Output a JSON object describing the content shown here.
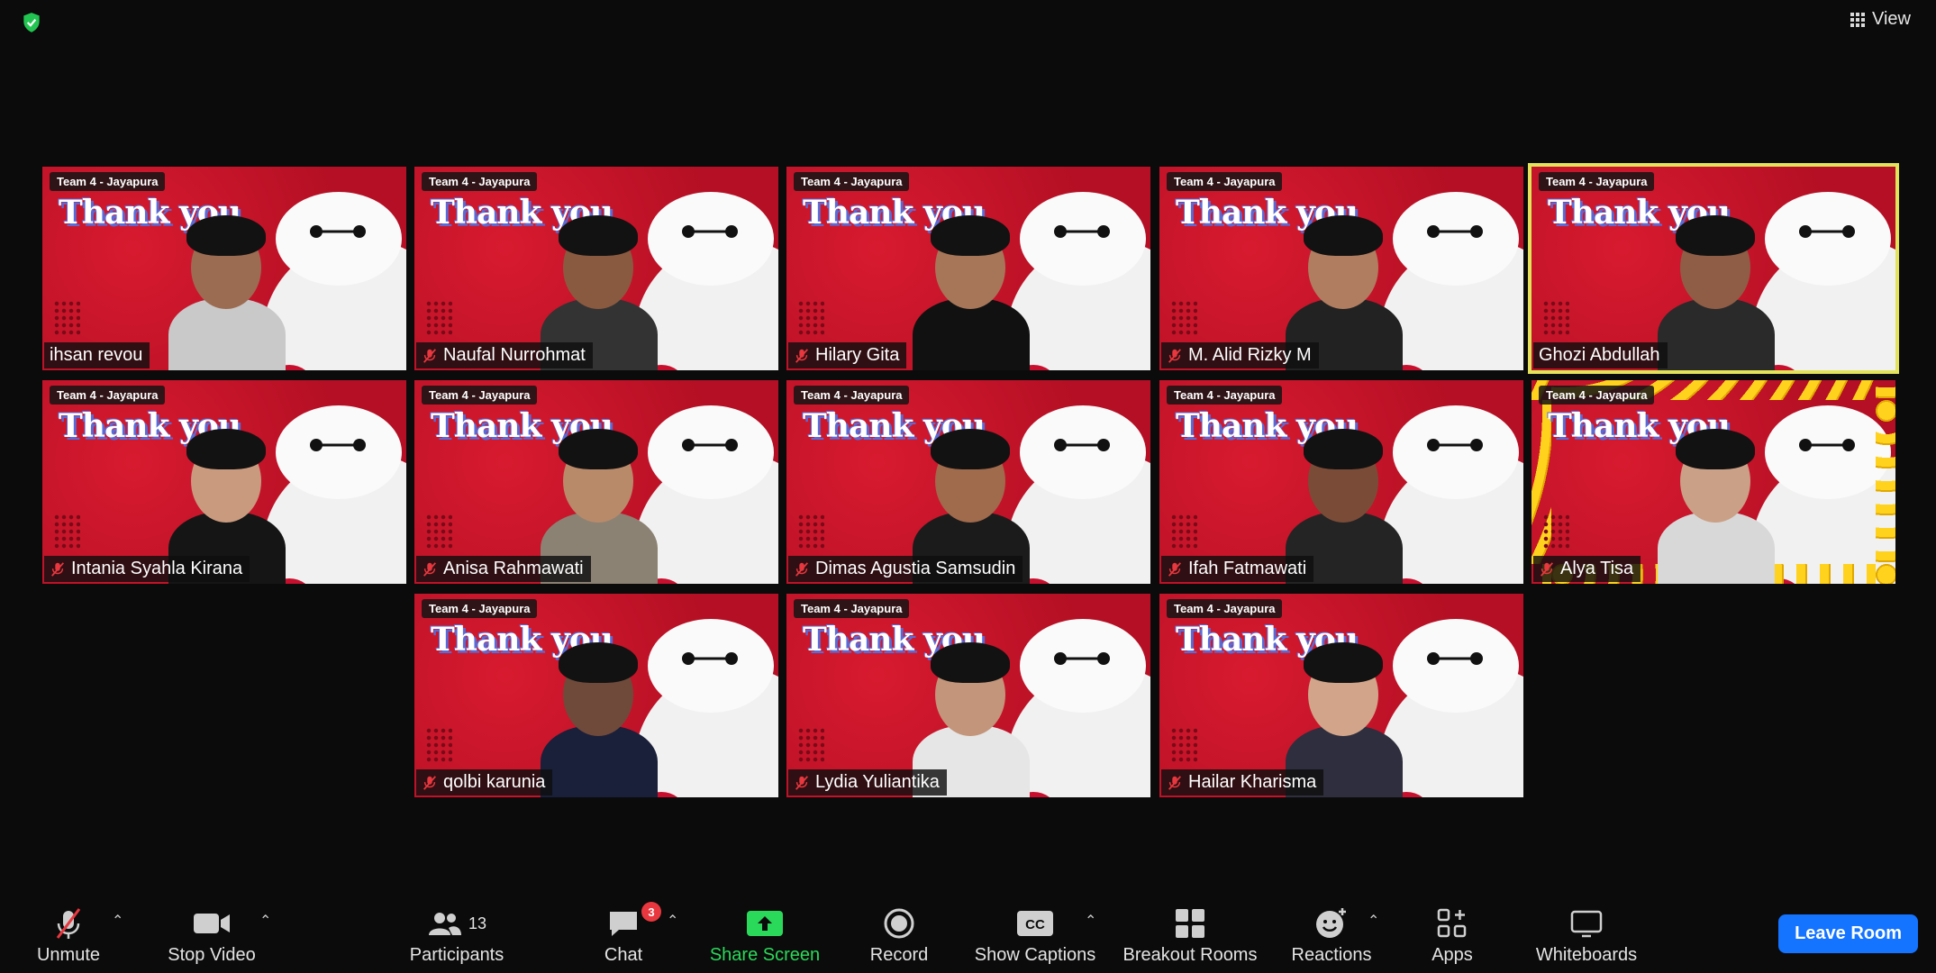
{
  "header": {
    "view_label": "View"
  },
  "meeting": {
    "team_label": "Team 4 - Jayapura",
    "overlay_text": "Thank you"
  },
  "participants": [
    {
      "name": "ihsan revou",
      "muted": false
    },
    {
      "name": "Naufal Nurrohmat",
      "muted": true
    },
    {
      "name": "Hilary Gita",
      "muted": true
    },
    {
      "name": "M. Alid Rizky M",
      "muted": true
    },
    {
      "name": "Ghozi Abdullah",
      "muted": false,
      "active_speaker": true
    },
    {
      "name": "Intania Syahla Kirana",
      "muted": true
    },
    {
      "name": "Anisa Rahmawati",
      "muted": true
    },
    {
      "name": "Dimas Agustia Samsudin",
      "muted": true
    },
    {
      "name": "Ifah Fatmawati",
      "muted": true
    },
    {
      "name": "Alya Tisa",
      "muted": true
    },
    {
      "name": "qolbi karunia",
      "muted": true
    },
    {
      "name": "Lydia Yuliantika",
      "muted": true
    },
    {
      "name": "Hailar Kharisma",
      "muted": true
    }
  ],
  "toolbar": {
    "unmute": "Unmute",
    "stop_video": "Stop Video",
    "participants": "Participants",
    "participants_count": "13",
    "chat": "Chat",
    "chat_badge": "3",
    "share_screen": "Share Screen",
    "record": "Record",
    "show_captions": "Show Captions",
    "breakout_rooms": "Breakout Rooms",
    "reactions": "Reactions",
    "apps": "Apps",
    "whiteboards": "Whiteboards",
    "leave_room": "Leave Room"
  },
  "colors": {
    "accent_blue": "#1473ff",
    "share_green": "#2bd95a",
    "active_border": "#e2e35a",
    "tile_red": "#c8102e"
  }
}
